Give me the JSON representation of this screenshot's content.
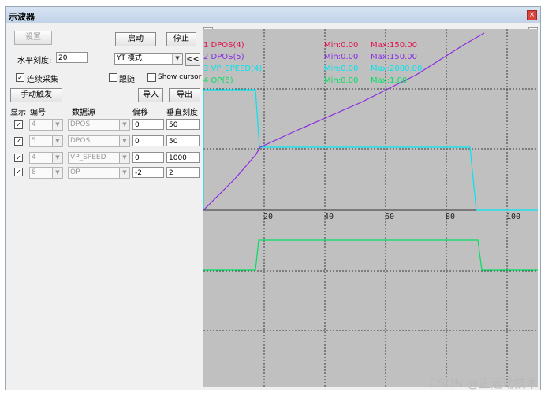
{
  "window": {
    "title": "示波器",
    "close_glyph": "×"
  },
  "controls": {
    "settings_button": "设置",
    "start_button": "启动",
    "stop_button": "停止",
    "hscale_label": "水平刻度:",
    "hscale_value": "20",
    "mode_value": "YT 模式",
    "collapse_button": "<<",
    "continuous_label": "连续采集",
    "continuous_checked": true,
    "follow_label": "跟随",
    "follow_checked": false,
    "cursor_label": "Show cursor",
    "cursor_checked": false,
    "trigger_button": "手动触发",
    "import_button": "导入",
    "export_button": "导出"
  },
  "channel_table": {
    "headers": [
      "显示",
      "编号",
      "数据源",
      "偏移",
      "垂直刻度"
    ],
    "rows": [
      {
        "show": true,
        "number": "4",
        "source": "DPOS",
        "offset": "0",
        "scale": "50"
      },
      {
        "show": true,
        "number": "5",
        "source": "DPOS",
        "offset": "0",
        "scale": "50"
      },
      {
        "show": true,
        "number": "4",
        "source": "VP_SPEED",
        "offset": "0",
        "scale": "1000"
      },
      {
        "show": true,
        "number": "8",
        "source": "OP",
        "offset": "-2",
        "scale": "2"
      }
    ]
  },
  "legend": [
    {
      "name": "1 DPOS(4)",
      "min": "Min:0.00",
      "max": "Max:150.00",
      "color": "#e0104a"
    },
    {
      "name": "2 DPOS(5)",
      "min": "Min:0.00",
      "max": "Max:150.00",
      "color": "#8a2be2"
    },
    {
      "name": "3 VP_SPEED(4)",
      "min": "Min:0.00",
      "max": "Max:2000.00",
      "color": "#00e5ee"
    },
    {
      "name": "4 OP(8)",
      "min": "Min:0.00",
      "max": "Max:1.00",
      "color": "#00e060"
    }
  ],
  "x_ticks": [
    "20",
    "40",
    "60",
    "80",
    "100"
  ],
  "watermark": "CSDN @正运动技术",
  "colors": {
    "plot_bg": "#c0c0c0",
    "grid": "#444444"
  }
}
